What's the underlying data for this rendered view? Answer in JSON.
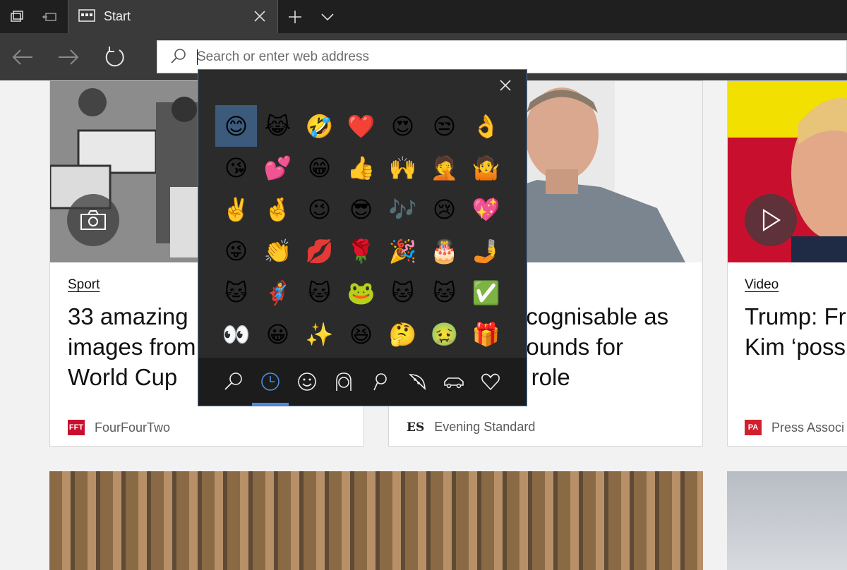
{
  "tab": {
    "title": "Start",
    "close_icon": "close-icon"
  },
  "titlebar_icons": [
    "tab-preview-icon",
    "set-aside-tabs-icon",
    "new-tab-icon",
    "tab-list-chevron-icon"
  ],
  "nav": {
    "back": "back-arrow-icon",
    "forward": "forward-arrow-icon",
    "refresh": "refresh-icon"
  },
  "address_bar": {
    "placeholder": "Search or enter web address",
    "value": ""
  },
  "cards": [
    {
      "category": "Sport",
      "title": "33 amazing\nimages from\nWorld Cup",
      "source": "FourFourTwo",
      "source_logo": "FFT",
      "overlay_icon": "camera-icon"
    },
    {
      "category": "",
      "title": "ecognisable as\npounds for\ny role",
      "source": "Evening Standard",
      "source_logo": "ES"
    },
    {
      "category": "Video",
      "title": "Trump: Fr\nKim ‘poss",
      "source": "Press Associ",
      "source_logo": "PA",
      "overlay_icon": "play-icon"
    }
  ],
  "emoji_panel": {
    "close_icon": "close-icon",
    "emojis": [
      [
        "😊",
        "😹",
        "🤣",
        "❤️",
        "😍",
        "😒",
        "👌"
      ],
      [
        "😘",
        "💕",
        "😁",
        "👍",
        "🙌",
        "🤦",
        "🤷"
      ],
      [
        "✌️",
        "🤞",
        "😉",
        "😎",
        "🎶",
        "😢",
        "💖"
      ],
      [
        "😜",
        "👏",
        "💋",
        "🌹",
        "🎉",
        "🎂",
        "🤳"
      ],
      [
        "🐱",
        "🦸",
        "🐱",
        "🐸",
        "🐱",
        "🐱",
        "✅"
      ],
      [
        "👀",
        "😀",
        "✨",
        "😆",
        "🤔",
        "🤢",
        "🎁"
      ]
    ],
    "selected": [
      0,
      0
    ],
    "categories": [
      "search-icon",
      "recent-clock-icon",
      "smiley-icon",
      "people-icon",
      "places-icon",
      "food-icon",
      "travel-car-icon",
      "heart-icon"
    ],
    "active_category": 1,
    "accent": "#4a8cdb"
  },
  "colors": {
    "selected_emoji_bg": "#3c5a7c",
    "ff_logo": "#c8102e",
    "pa_logo": "#d0202e"
  }
}
